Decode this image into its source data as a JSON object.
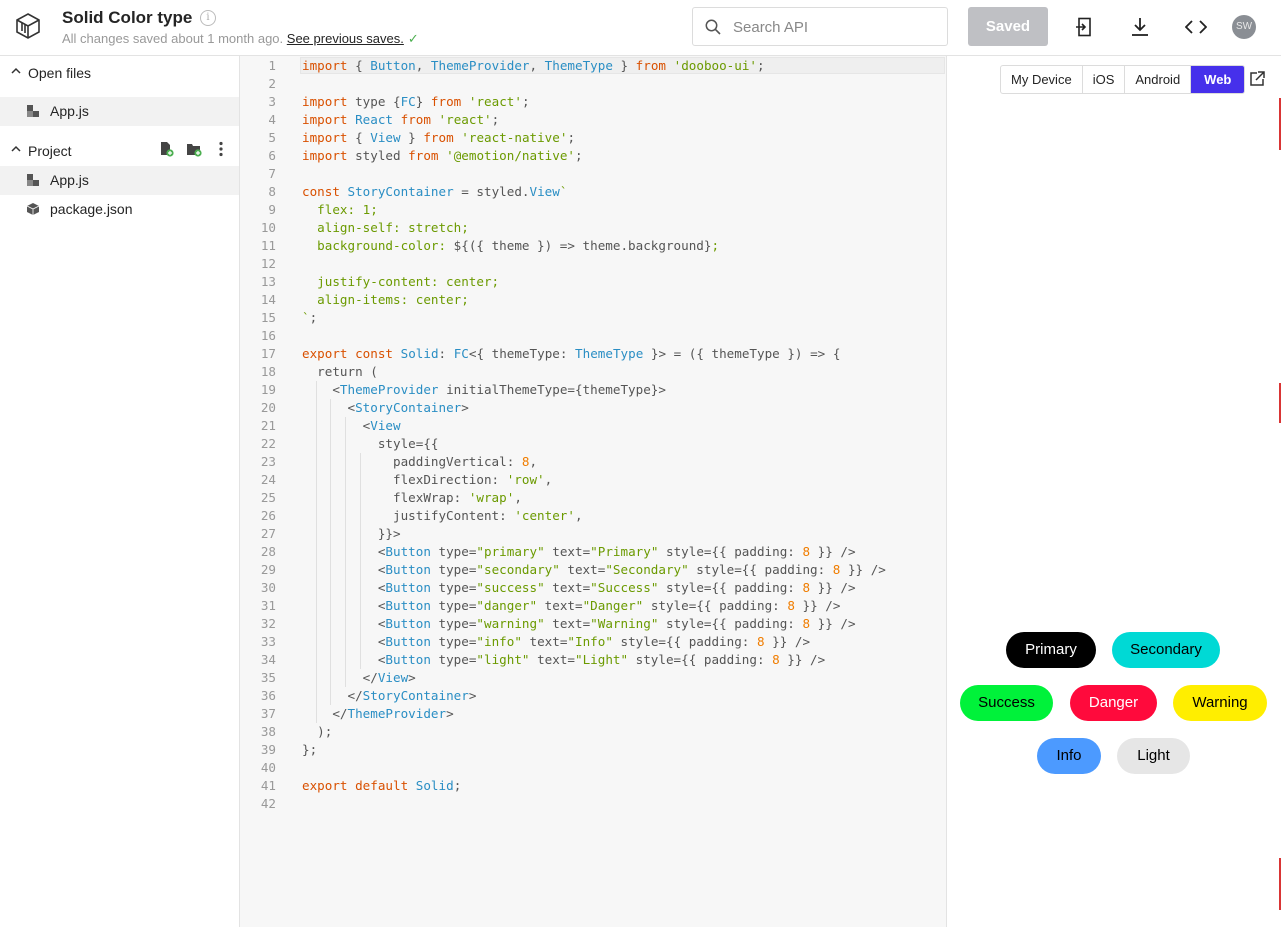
{
  "header": {
    "title": "Solid Color type",
    "status": "All changes saved about 1 month ago.",
    "previous_saves": "See previous saves.",
    "check": "✓",
    "info": "i",
    "search_placeholder": "Search API",
    "saved_label": "Saved",
    "avatar": "SW"
  },
  "sidebar": {
    "open_files": "Open files",
    "open_file": "App.js",
    "project": "Project",
    "files": [
      "App.js",
      "package.json"
    ]
  },
  "editor": {
    "lines": [
      [
        [
          "import",
          "kw"
        ],
        [
          " { ",
          ""
        ],
        [
          "Button",
          "ty"
        ],
        [
          ", ",
          ""
        ],
        [
          "ThemeProvider",
          "ty"
        ],
        [
          ", ",
          ""
        ],
        [
          "ThemeType",
          "ty"
        ],
        [
          " } ",
          ""
        ],
        [
          "from",
          "kw"
        ],
        [
          " ",
          ""
        ],
        [
          "'dooboo-ui'",
          "st"
        ],
        [
          ";",
          ""
        ]
      ],
      [],
      [
        [
          "import",
          "kw"
        ],
        [
          " type {",
          ""
        ],
        [
          "FC",
          "ty"
        ],
        [
          "} ",
          ""
        ],
        [
          "from",
          "kw"
        ],
        [
          " ",
          ""
        ],
        [
          "'react'",
          "st"
        ],
        [
          ";",
          ""
        ]
      ],
      [
        [
          "import",
          "kw"
        ],
        [
          " ",
          ""
        ],
        [
          "React",
          "ty"
        ],
        [
          " ",
          ""
        ],
        [
          "from",
          "kw"
        ],
        [
          " ",
          ""
        ],
        [
          "'react'",
          "st"
        ],
        [
          ";",
          ""
        ]
      ],
      [
        [
          "import",
          "kw"
        ],
        [
          " { ",
          ""
        ],
        [
          "View",
          "ty"
        ],
        [
          " } ",
          ""
        ],
        [
          "from",
          "kw"
        ],
        [
          " ",
          ""
        ],
        [
          "'react-native'",
          "st"
        ],
        [
          ";",
          ""
        ]
      ],
      [
        [
          "import",
          "kw"
        ],
        [
          " styled ",
          ""
        ],
        [
          "from",
          "kw"
        ],
        [
          " ",
          ""
        ],
        [
          "'@emotion/native'",
          "st"
        ],
        [
          ";",
          ""
        ]
      ],
      [],
      [
        [
          "const",
          "kw"
        ],
        [
          " ",
          ""
        ],
        [
          "StoryContainer",
          "ty"
        ],
        [
          " = styled.",
          ""
        ],
        [
          "View",
          "ty"
        ],
        [
          "`",
          "st"
        ]
      ],
      [
        [
          "  flex: 1;",
          "st"
        ]
      ],
      [
        [
          "  align-self: stretch;",
          "st"
        ]
      ],
      [
        [
          "  background-color: ",
          "st"
        ],
        [
          "${({ theme }) => theme.background}",
          ""
        ],
        [
          ";",
          "st"
        ]
      ],
      [],
      [
        [
          "  justify-content: center;",
          "st"
        ]
      ],
      [
        [
          "  align-items: center;",
          "st"
        ]
      ],
      [
        [
          "`",
          "st"
        ],
        [
          ";",
          ""
        ]
      ],
      [],
      [
        [
          "export",
          "kw"
        ],
        [
          " ",
          ""
        ],
        [
          "const",
          "kw"
        ],
        [
          " ",
          ""
        ],
        [
          "Solid",
          "ty"
        ],
        [
          ": ",
          ""
        ],
        [
          "FC",
          "ty"
        ],
        [
          "<{ themeType: ",
          ""
        ],
        [
          "ThemeType",
          "ty"
        ],
        [
          " }> = ({ themeType }) => {",
          ""
        ]
      ],
      [
        [
          "  return (",
          ""
        ]
      ],
      [
        [
          "    <",
          ""
        ],
        [
          "ThemeProvider",
          "ty"
        ],
        [
          " initialThemeType={themeType}>",
          ""
        ]
      ],
      [
        [
          "      <",
          ""
        ],
        [
          "StoryContainer",
          "ty"
        ],
        [
          ">",
          ""
        ]
      ],
      [
        [
          "        <",
          ""
        ],
        [
          "View",
          "ty"
        ]
      ],
      [
        [
          "          style={{",
          ""
        ]
      ],
      [
        [
          "            paddingVertical: ",
          ""
        ],
        [
          "8",
          "nu"
        ],
        [
          ",",
          ""
        ]
      ],
      [
        [
          "            flexDirection: ",
          ""
        ],
        [
          "'row'",
          "st"
        ],
        [
          ",",
          ""
        ]
      ],
      [
        [
          "            flexWrap: ",
          ""
        ],
        [
          "'wrap'",
          "st"
        ],
        [
          ",",
          ""
        ]
      ],
      [
        [
          "            justifyContent: ",
          ""
        ],
        [
          "'center'",
          "st"
        ],
        [
          ",",
          ""
        ]
      ],
      [
        [
          "          }}>",
          ""
        ]
      ],
      [
        [
          "          <",
          ""
        ],
        [
          "Button",
          "ty"
        ],
        [
          " type=",
          ""
        ],
        [
          "\"primary\"",
          "st"
        ],
        [
          " text=",
          ""
        ],
        [
          "\"Primary\"",
          "st"
        ],
        [
          " style={{ padding: ",
          ""
        ],
        [
          "8",
          "nu"
        ],
        [
          " }} />",
          ""
        ]
      ],
      [
        [
          "          <",
          ""
        ],
        [
          "Button",
          "ty"
        ],
        [
          " type=",
          ""
        ],
        [
          "\"secondary\"",
          "st"
        ],
        [
          " text=",
          ""
        ],
        [
          "\"Secondary\"",
          "st"
        ],
        [
          " style={{ padding: ",
          ""
        ],
        [
          "8",
          "nu"
        ],
        [
          " }} />",
          ""
        ]
      ],
      [
        [
          "          <",
          ""
        ],
        [
          "Button",
          "ty"
        ],
        [
          " type=",
          ""
        ],
        [
          "\"success\"",
          "st"
        ],
        [
          " text=",
          ""
        ],
        [
          "\"Success\"",
          "st"
        ],
        [
          " style={{ padding: ",
          ""
        ],
        [
          "8",
          "nu"
        ],
        [
          " }} />",
          ""
        ]
      ],
      [
        [
          "          <",
          ""
        ],
        [
          "Button",
          "ty"
        ],
        [
          " type=",
          ""
        ],
        [
          "\"danger\"",
          "st"
        ],
        [
          " text=",
          ""
        ],
        [
          "\"Danger\"",
          "st"
        ],
        [
          " style={{ padding: ",
          ""
        ],
        [
          "8",
          "nu"
        ],
        [
          " }} />",
          ""
        ]
      ],
      [
        [
          "          <",
          ""
        ],
        [
          "Button",
          "ty"
        ],
        [
          " type=",
          ""
        ],
        [
          "\"warning\"",
          "st"
        ],
        [
          " text=",
          ""
        ],
        [
          "\"Warning\"",
          "st"
        ],
        [
          " style={{ padding: ",
          ""
        ],
        [
          "8",
          "nu"
        ],
        [
          " }} />",
          ""
        ]
      ],
      [
        [
          "          <",
          ""
        ],
        [
          "Button",
          "ty"
        ],
        [
          " type=",
          ""
        ],
        [
          "\"info\"",
          "st"
        ],
        [
          " text=",
          ""
        ],
        [
          "\"Info\"",
          "st"
        ],
        [
          " style={{ padding: ",
          ""
        ],
        [
          "8",
          "nu"
        ],
        [
          " }} />",
          ""
        ]
      ],
      [
        [
          "          <",
          ""
        ],
        [
          "Button",
          "ty"
        ],
        [
          " type=",
          ""
        ],
        [
          "\"light\"",
          "st"
        ],
        [
          " text=",
          ""
        ],
        [
          "\"Light\"",
          "st"
        ],
        [
          " style={{ padding: ",
          ""
        ],
        [
          "8",
          "nu"
        ],
        [
          " }} />",
          ""
        ]
      ],
      [
        [
          "        </",
          ""
        ],
        [
          "View",
          "ty"
        ],
        [
          ">",
          ""
        ]
      ],
      [
        [
          "      </",
          ""
        ],
        [
          "StoryContainer",
          "ty"
        ],
        [
          ">",
          ""
        ]
      ],
      [
        [
          "    </",
          ""
        ],
        [
          "ThemeProvider",
          "ty"
        ],
        [
          ">",
          ""
        ]
      ],
      [
        [
          "  );",
          ""
        ]
      ],
      [
        [
          "};",
          ""
        ]
      ],
      [],
      [
        [
          "export",
          "kw"
        ],
        [
          " ",
          ""
        ],
        [
          "default",
          "kw"
        ],
        [
          " ",
          ""
        ],
        [
          "Solid",
          "ty"
        ],
        [
          ";",
          ""
        ]
      ],
      []
    ]
  },
  "preview": {
    "tabs": [
      "My Device",
      "iOS",
      "Android",
      "Web"
    ],
    "selected_tab": "Web",
    "buttons": [
      {
        "label": "Primary",
        "bg": "#000000",
        "fg": "#ffffff"
      },
      {
        "label": "Secondary",
        "bg": "#00d9d5",
        "fg": "#000000"
      },
      {
        "label": "Success",
        "bg": "#00f23a",
        "fg": "#000000"
      },
      {
        "label": "Danger",
        "bg": "#ff0a3c",
        "fg": "#ffffff"
      },
      {
        "label": "Warning",
        "bg": "#ffee00",
        "fg": "#000000"
      },
      {
        "label": "Info",
        "bg": "#4c9aff",
        "fg": "#000000"
      },
      {
        "label": "Light",
        "bg": "#e6e6e6",
        "fg": "#000000"
      }
    ]
  },
  "colors": {
    "accent": "#4630eb",
    "saved_button": "#bfc0c4",
    "keyword": "#d95000",
    "type": "#2a8ec4",
    "string": "#6b9a00",
    "number": "#f07d00"
  }
}
